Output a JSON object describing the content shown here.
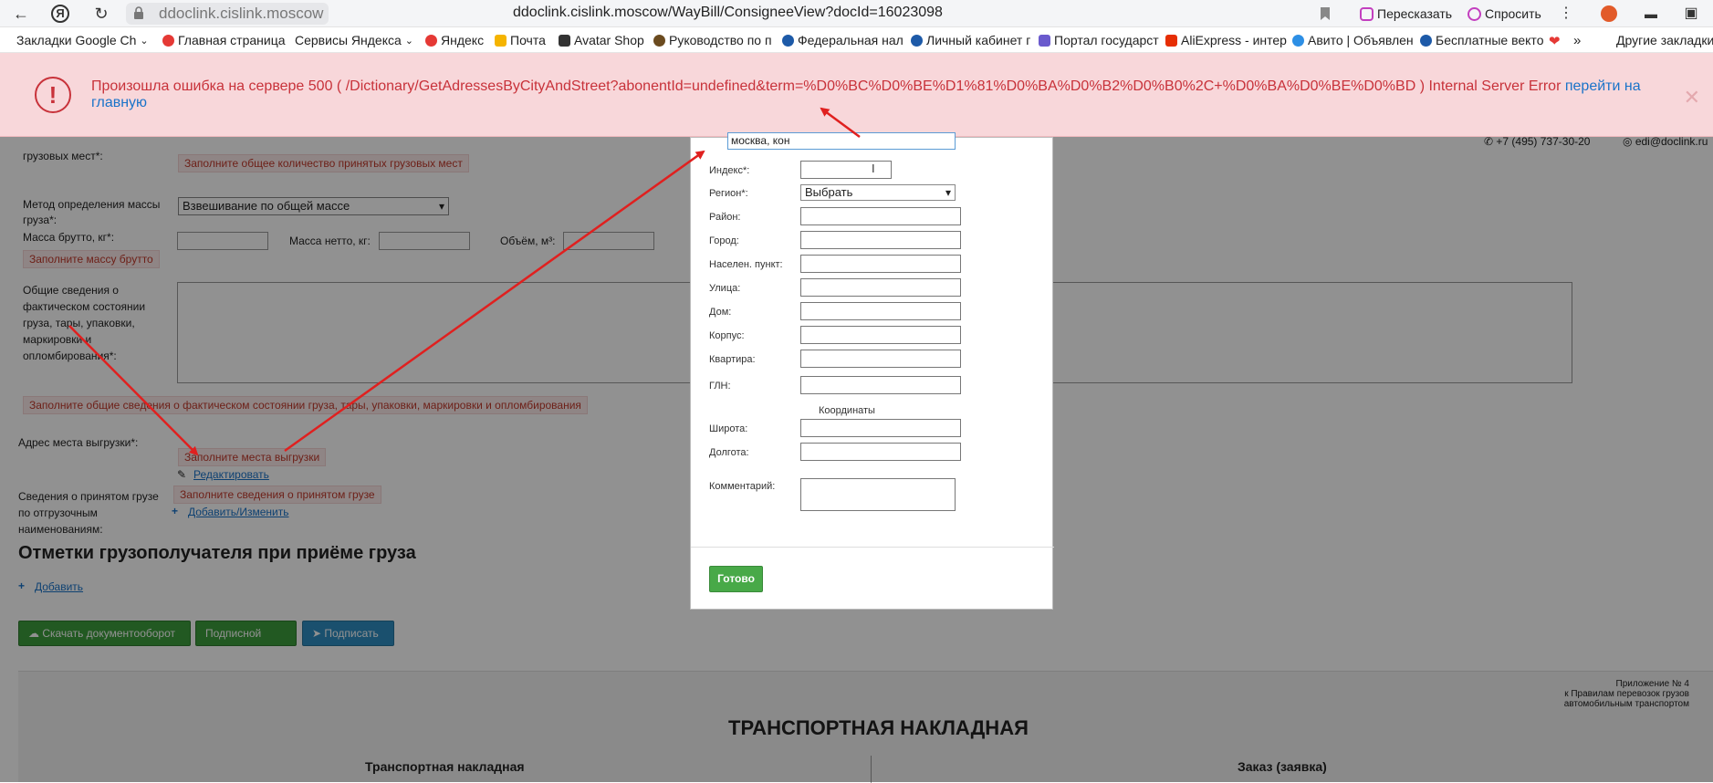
{
  "browser": {
    "url_host": "ddoclink.cislink.moscow",
    "url_full": "ddoclink.cislink.moscow/WayBill/ConsigneeView?docId=16023098",
    "retell_label": "Пересказать",
    "ask_label": "Спросить",
    "bookmarks": [
      {
        "label": "Закладки Google Ch",
        "color": "#ffffff"
      },
      {
        "label": "Главная страница",
        "color": "#e53935"
      },
      {
        "label": "Сервисы Яндекса",
        "color": "#ffffff"
      },
      {
        "label": "Яндекс",
        "color": "#e53935"
      },
      {
        "label": "Почта",
        "color": "#f5b400"
      },
      {
        "label": "Avatar Shop",
        "color": "#333333"
      },
      {
        "label": "Руководство по п",
        "color": "#6b4b1f"
      },
      {
        "label": "Федеральная нал",
        "color": "#1d5aa8"
      },
      {
        "label": "Личный кабинет г",
        "color": "#1d5aa8"
      },
      {
        "label": "Портал государст",
        "color": "#6a5acd"
      },
      {
        "label": "AliExpress - интер",
        "color": "#e62e04"
      },
      {
        "label": "Авито | Объявлен",
        "color": "#2d8fe5"
      },
      {
        "label": "Бесплатные векто",
        "color": "#1d5aa8"
      }
    ],
    "other_bookmarks": "Другие закладки"
  },
  "error": {
    "text": "Произошла ошибка на сервере 500 ( /Dictionary/GetAdressesByCityAndStreet?abonentId=undefined&term=%D0%BC%D0%BE%D1%81%D0%BA%D0%B2%D0%B0%2C+%D0%BA%D0%BE%D0%BD ) Internal Server Error",
    "link": "перейти на главную",
    "color": "#c8323a"
  },
  "header_contacts": {
    "phone": "+7 (495) 737-30-20",
    "email": "edi@doclink.ru"
  },
  "form": {
    "cargo_places_label": "грузовых мест*:",
    "cargo_places_error": "Заполните общее количество принятых грузовых мест",
    "mass_method_label": "Метод определения массы груза*:",
    "mass_method_value": "Взвешивание по общей массе",
    "gross_label": "Масса брутто, кг*:",
    "net_label": "Масса нетто, кг:",
    "volume_label": "Объём, м³:",
    "gross_error": "Заполните массу брутто",
    "general_label": "Общие сведения о фактическом состоянии груза, тары, упаковки, маркировки и опломбирования*:",
    "general_error": "Заполните общие сведения о фактическом состоянии груза, тары, упаковки, маркировки и опломбирования",
    "unload_label": "Адрес места выгрузки*:",
    "unload_error": "Заполните места выгрузки",
    "edit_link": "Редактировать",
    "accepted_label": "Сведения о принятом грузе по отгрузочным наименованиям:",
    "accepted_error": "Заполните сведения о принятом грузе",
    "add_change_link": "Добавить/Изменить",
    "marks_heading": "Отметки грузополучателя при приёме груза",
    "add_link": "Добавить",
    "btn_download": "Скачать документооборот",
    "btn_sheet": "Подписной лист",
    "btn_sign": "Подписать"
  },
  "document": {
    "annex_line1": "Приложение № 4",
    "annex_line2": "к Правилам перевозок грузов",
    "annex_line3": "автомобильным транспортом",
    "title": "ТРАНСПОРТНАЯ НАКЛАДНАЯ",
    "col_left": "Транспортная накладная",
    "col_right": "Заказ (заявка)"
  },
  "modal": {
    "search_value": "москва, кон",
    "index_label": "Индекс*:",
    "region_label": "Регион*:",
    "region_value": "Выбрать",
    "district_label": "Район:",
    "city_label": "Город:",
    "settlement_label": "Населен. пункт:",
    "street_label": "Улица:",
    "house_label": "Дом:",
    "building_label": "Корпус:",
    "apartment_label": "Квартира:",
    "gln_label": "ГЛН:",
    "coords_label": "Координаты",
    "lat_label": "Широта:",
    "lon_label": "Долгота:",
    "comment_label": "Комментарий:",
    "done_label": "Готово"
  }
}
